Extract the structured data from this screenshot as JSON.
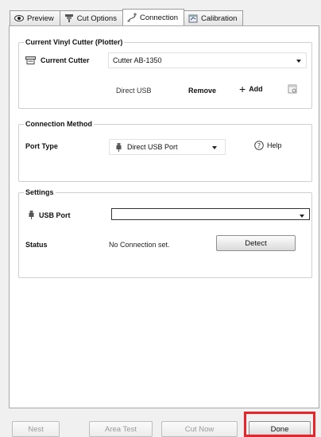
{
  "tabs": [
    {
      "label": "Preview",
      "icon": "eye-icon"
    },
    {
      "label": "Cut Options",
      "icon": "cutter-icon"
    },
    {
      "label": "Connection",
      "icon": "connection-cable-icon",
      "active": true
    },
    {
      "label": "Calibration",
      "icon": "calibration-icon"
    }
  ],
  "current_cutter": {
    "title": "Current Vinyl Cutter (Plotter)",
    "label": "Current Cutter",
    "selected": "Cutter AB-1350",
    "connection_info": "Direct USB",
    "remove_label": "Remove",
    "add_label": "Add"
  },
  "connection_method": {
    "title": "Connection Method",
    "port_type_label": "Port Type",
    "port_type_value": "Direct USB Port",
    "help_label": "Help"
  },
  "settings": {
    "title": "Settings",
    "usb_port_label": "USB Port",
    "usb_port_value": "",
    "status_label": "Status",
    "status_value": "No Connection set.",
    "detect_label": "Detect"
  },
  "footer": {
    "nest_label": "Nest",
    "area_test_label": "Area Test",
    "cut_now_label": "Cut Now",
    "done_label": "Done",
    "highlight_color": "#e8232a"
  }
}
